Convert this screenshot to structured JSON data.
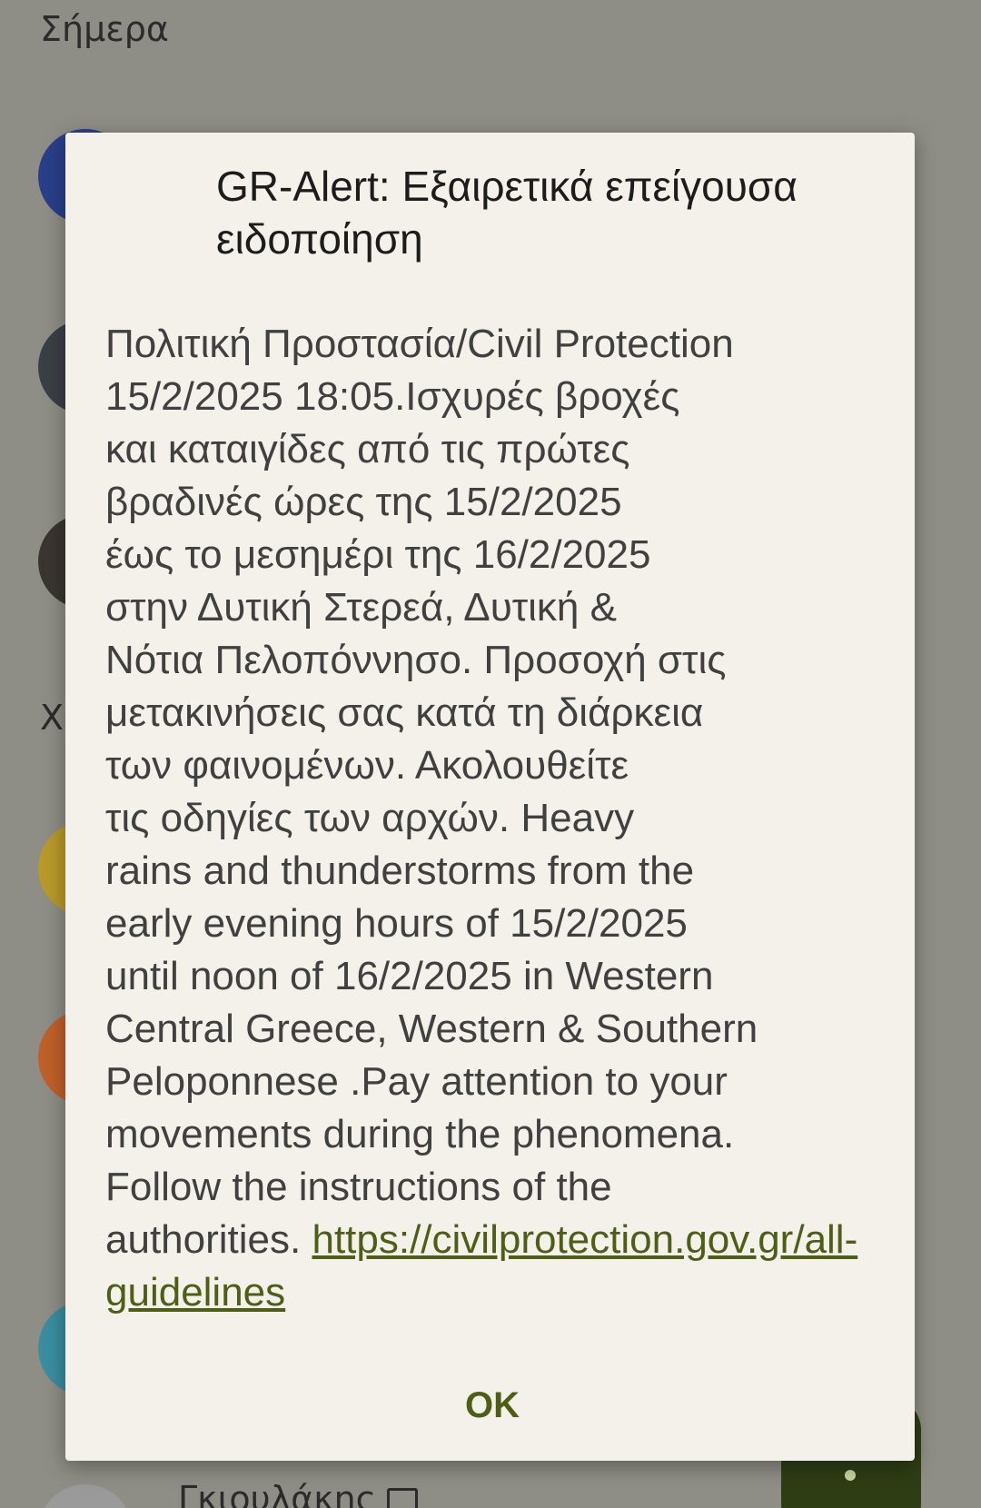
{
  "background": {
    "section_today": "Σήμερα",
    "section_earlier_fragment": "Χθ",
    "bottom_contact_fragment": "Γκιουλάκης",
    "avatars": [
      {
        "color": "#2a3f8a"
      },
      {
        "color": "#3b3f46"
      },
      {
        "color": "#3a3530"
      },
      {
        "color": "#b89a2b"
      },
      {
        "color": "#c0602a"
      },
      {
        "color": "#3a8ea0"
      },
      {
        "color": "#9a9a9a"
      }
    ]
  },
  "dialog": {
    "title": "GR-Alert: Εξαιρετικά επείγουσα ειδοποίηση",
    "body": "Πολιτική Προστασία/Civil Protection\n15/2/2025 18:05.Ισχυρές βροχές\nκαι καταιγίδες από τις πρώτες\nβραδινές ώρες της 15/2/2025\nέως το μεσημέρι της 16/2/2025\nστην Δυτική Στερεά, Δυτική &\nΝότια Πελοπόννησο. Προσοχή στις\nμετακινήσεις σας κατά τη διάρκεια\nτων φαινομένων. Ακολουθείτε\nτις οδηγίες των αρχών. Heavy\nrains and thunderstorms from the\nearly evening hours of 15/2/2025\nuntil noon of 16/2/2025 in Western\nCentral Greece, Western & Southern\nPeloponnese .Pay attention to your\nmovements during the phenomena.\nFollow the instructions of the\nauthorities. ",
    "link": "https://civilprotection.gov.gr/all-guidelines",
    "ok_label": "OK"
  },
  "colors": {
    "accent": "#4e5e16",
    "dialog_bg": "#f3f1ea",
    "scrim": "#8e8e86"
  }
}
